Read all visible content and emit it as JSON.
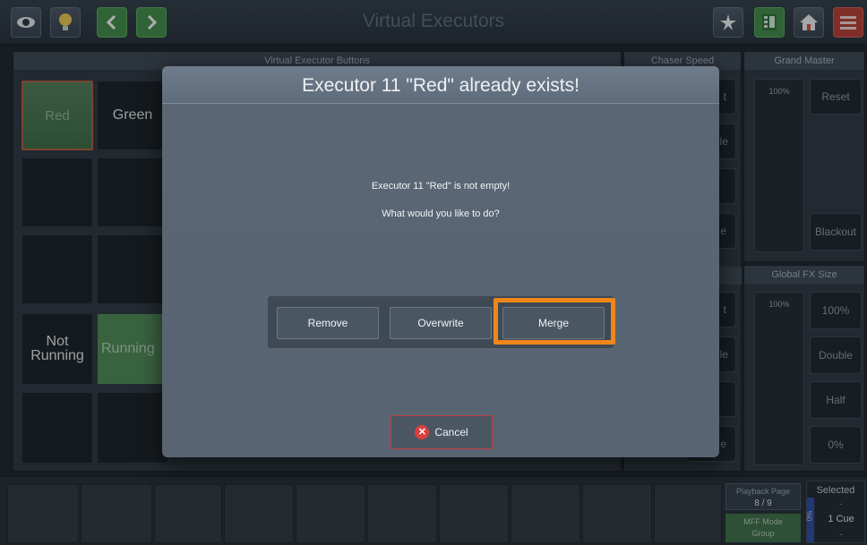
{
  "topbar": {
    "title": "Virtual Executors",
    "icons": [
      "eye-icon",
      "bulb-icon",
      "back-icon",
      "forward-icon",
      "star-icon",
      "grid-icon",
      "home-icon",
      "menu-icon"
    ]
  },
  "panels": {
    "executor_buttons_title": "Virtual Executor Buttons",
    "chaser_speed_title": "Chaser Speed",
    "grand_master_title": "Grand Master",
    "global_fx_size_title": "Global FX Size"
  },
  "executors": {
    "red": "Red",
    "green": "Green",
    "not_running_line1": "Not",
    "not_running_line2": "Running",
    "running": "Running"
  },
  "chaser_partial": [
    "t",
    "le",
    "e",
    "t",
    "le",
    "e"
  ],
  "grand_master": {
    "fader_value": "100%",
    "reset": "Reset",
    "blackout": "Blackout"
  },
  "global_fx": {
    "fader_value": "100%",
    "btn_100": "100%",
    "btn_double": "Double",
    "btn_half": "Half",
    "btn_0": "0%"
  },
  "bottom": {
    "playback_page_label": "Playback Page",
    "playback_page_value": "8 / 9",
    "mff_mode_label": "MFF Mode",
    "mff_mode_value": "Group",
    "selected_label": "Selected",
    "selected_dash1": "-",
    "selected_value": "1 Cue",
    "selected_dash2": "-",
    "selected_side": "0%"
  },
  "dialog": {
    "title": "Executor 11 \"Red\" already exists!",
    "message_line1": "Executor 11 \"Red\" is not empty!",
    "message_line2": "What would you like to do?",
    "remove": "Remove",
    "overwrite": "Overwrite",
    "merge": "Merge",
    "cancel": "Cancel"
  },
  "colors": {
    "highlight": "#f0861a",
    "cancel_border": "#c04040"
  }
}
